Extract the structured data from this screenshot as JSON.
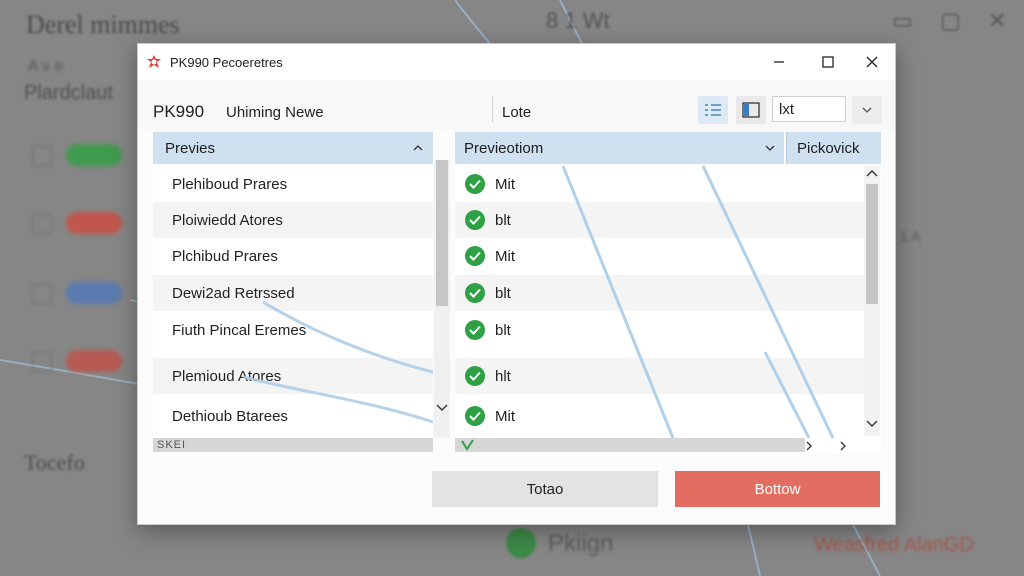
{
  "background_app": {
    "title": "Derel mimmes",
    "subtitle_1": "A v e",
    "subtitle_2": "Plardclaut",
    "footer_left": "Tocefo",
    "footer_middle": "Pkiign",
    "footer_right": "Weasfred AlanGD",
    "top_center": "8 1 Wt",
    "right_label": "1 A"
  },
  "dialog": {
    "title": "PK990 Pecoeretres",
    "app_name": "PK990",
    "subtitle": "Uhiming Newe",
    "lote_label": "Lote",
    "filter_value": "lxt",
    "left_list": {
      "header": "Previes",
      "rows": [
        "Plehiboud Prares",
        "Ploiwiedd Atores",
        "Plchibud Prares",
        "Dewi2ad Retrssed",
        "Fiuth Pincal Eremes",
        "Plemioud Atores",
        "Dethioub Btarees"
      ],
      "footer": "SKEI"
    },
    "right_list": {
      "header_1": "Previeotiom",
      "header_2": "Pickovick",
      "rows": [
        "Mit",
        "blt",
        "Mit",
        "blt",
        "blt",
        "hlt",
        "Mit"
      ]
    },
    "buttons": {
      "total": "Totao",
      "bottom": "Bottow"
    }
  },
  "colors": {
    "header_blue": "#cfe0f1",
    "check_green": "#2fa043",
    "accent_red": "#e26e62",
    "line_blue": "#a9cbe8"
  }
}
